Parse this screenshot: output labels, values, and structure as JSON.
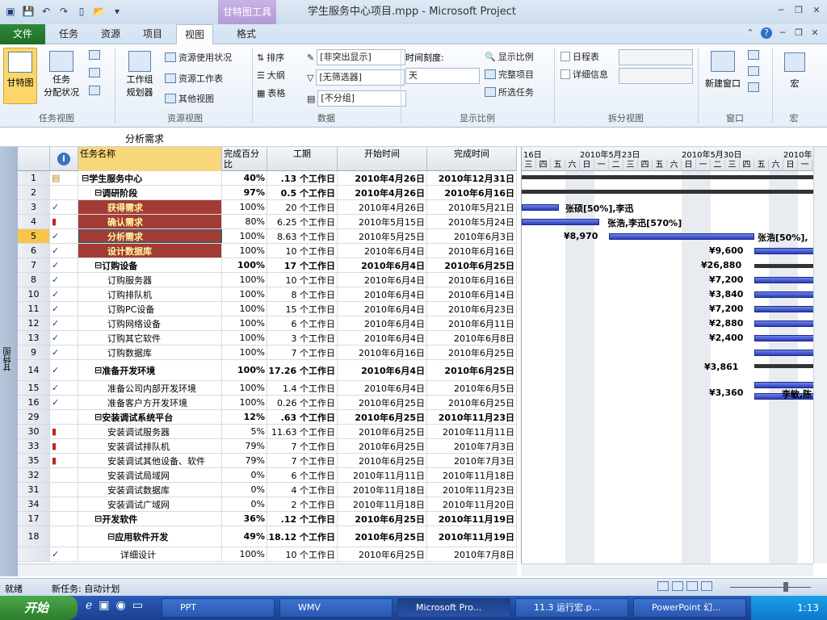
{
  "window": {
    "title": "学生服务中心项目.mpp - Microsoft Project",
    "context_tab_group": "甘特图工具"
  },
  "tabs": [
    "任务",
    "资源",
    "项目",
    "视图",
    "格式"
  ],
  "file_tab": "文件",
  "ribbon": {
    "task_view": {
      "gantt": "甘特图",
      "assign": "任务\n分配状况",
      "label": "任务视图"
    },
    "resource_view": {
      "team_planner": "工作组\n规划器",
      "usage": "资源使用状况",
      "sheet": "资源工作表",
      "other": "其他视图",
      "label": "资源视图"
    },
    "data": {
      "sort": "排序",
      "outline": "大纲",
      "tables": "表格",
      "highlight": "[非突出显示]",
      "filter": "[无筛选器]",
      "group": "[不分组]",
      "label": "数据"
    },
    "zoom": {
      "timescale_label": "时间刻度:",
      "timescale_value": "天",
      "zoom": "显示比例",
      "entire_project": "完整项目",
      "selected_tasks": "所选任务",
      "label": "显示比例"
    },
    "split": {
      "timeline": "日程表",
      "details": "详细信息",
      "label": "拆分视图"
    },
    "window": {
      "new_window": "新建窗口",
      "label": "窗口"
    },
    "macros": {
      "macros": "宏",
      "label": "宏"
    }
  },
  "entry_bar": {
    "value": "分析需求"
  },
  "grid": {
    "headers": {
      "info": "i",
      "name": "任务名称",
      "pct": "完成百分比",
      "duration": "工期",
      "start": "开始时间",
      "finish": "完成时间"
    },
    "rows": [
      {
        "id": "1",
        "ind": "note",
        "name": "学生服务中心",
        "lvl": 0,
        "sum": true,
        "pct": "40%",
        "dur": ".13 个工作日",
        "start": "2010年4月26日",
        "finish": "2010年12月31日"
      },
      {
        "id": "2",
        "ind": "",
        "name": "调研阶段",
        "lvl": 1,
        "sum": true,
        "pct": "97%",
        "dur": "0.5 个工作日",
        "start": "2010年4月26日",
        "finish": "2010年6月16日"
      },
      {
        "id": "3",
        "ind": "check",
        "name": "获得需求",
        "lvl": 2,
        "hl": true,
        "pct": "100%",
        "dur": "20 个工作日",
        "start": "2010年4月26日",
        "finish": "2010年5月21日"
      },
      {
        "id": "4",
        "ind": "person",
        "name": "确认需求",
        "lvl": 2,
        "hl": true,
        "pct": "80%",
        "dur": "6.25 个工作日",
        "start": "2010年5月15日",
        "finish": "2010年5月24日"
      },
      {
        "id": "5",
        "ind": "check",
        "name": "分析需求",
        "lvl": 2,
        "hl": true,
        "sel": true,
        "pct": "100%",
        "dur": "8.63 个工作日",
        "start": "2010年5月25日",
        "finish": "2010年6月3日"
      },
      {
        "id": "6",
        "ind": "check",
        "name": "设计数据库",
        "lvl": 2,
        "hl": true,
        "pct": "100%",
        "dur": "10 个工作日",
        "start": "2010年6月4日",
        "finish": "2010年6月16日"
      },
      {
        "id": "7",
        "ind": "check",
        "name": "订购设备",
        "lvl": 1,
        "sum": true,
        "pct": "100%",
        "dur": "17 个工作日",
        "start": "2010年6月4日",
        "finish": "2010年6月25日"
      },
      {
        "id": "8",
        "ind": "check",
        "name": "订购服务器",
        "lvl": 2,
        "pct": "100%",
        "dur": "10 个工作日",
        "start": "2010年6月4日",
        "finish": "2010年6月16日"
      },
      {
        "id": "10",
        "ind": "check",
        "name": "订购排队机",
        "lvl": 2,
        "pct": "100%",
        "dur": "8 个工作日",
        "start": "2010年6月4日",
        "finish": "2010年6月14日"
      },
      {
        "id": "11",
        "ind": "check",
        "name": "订购PC设备",
        "lvl": 2,
        "pct": "100%",
        "dur": "15 个工作日",
        "start": "2010年6月4日",
        "finish": "2010年6月23日"
      },
      {
        "id": "12",
        "ind": "check",
        "name": "订购网络设备",
        "lvl": 2,
        "pct": "100%",
        "dur": "6 个工作日",
        "start": "2010年6月4日",
        "finish": "2010年6月11日"
      },
      {
        "id": "13",
        "ind": "check",
        "name": "订购其它软件",
        "lvl": 2,
        "pct": "100%",
        "dur": "3 个工作日",
        "start": "2010年6月4日",
        "finish": "2010年6月8日"
      },
      {
        "id": "9",
        "ind": "check",
        "name": "订购数据库",
        "lvl": 2,
        "pct": "100%",
        "dur": "7 个工作日",
        "start": "2010年6月16日",
        "finish": "2010年6月25日"
      },
      {
        "id": "14",
        "ind": "check",
        "name": "准备开发环境",
        "lvl": 1,
        "sum": true,
        "tall": true,
        "pct": "100%",
        "dur": "17.26 个工作日",
        "start": "2010年6月4日",
        "finish": "2010年6月25日"
      },
      {
        "id": "15",
        "ind": "check",
        "name": "准备公司内部开发环境",
        "lvl": 2,
        "pct": "100%",
        "dur": "1.4 个工作日",
        "start": "2010年6月4日",
        "finish": "2010年6月5日"
      },
      {
        "id": "16",
        "ind": "check",
        "name": "准备客户方开发环境",
        "lvl": 2,
        "pct": "100%",
        "dur": "0.26 个工作日",
        "start": "2010年6月25日",
        "finish": "2010年6月25日"
      },
      {
        "id": "29",
        "ind": "",
        "name": "安装调试系统平台",
        "lvl": 1,
        "sum": true,
        "pct": "12%",
        "dur": ".63 个工作日",
        "start": "2010年6月25日",
        "finish": "2010年11月23日"
      },
      {
        "id": "30",
        "ind": "person",
        "name": "安装调试服务器",
        "lvl": 2,
        "pct": "5%",
        "dur": "11.63 个工作日",
        "start": "2010年6月25日",
        "finish": "2010年11月11日"
      },
      {
        "id": "33",
        "ind": "person",
        "name": "安装调试排队机",
        "lvl": 2,
        "pct": "79%",
        "dur": "7 个工作日",
        "start": "2010年6月25日",
        "finish": "2010年7月3日"
      },
      {
        "id": "35",
        "ind": "person",
        "name": "安装调试其他设备、软件",
        "lvl": 2,
        "pct": "79%",
        "dur": "7 个工作日",
        "start": "2010年6月25日",
        "finish": "2010年7月3日"
      },
      {
        "id": "32",
        "ind": "",
        "name": "安装调试局域网",
        "lvl": 2,
        "pct": "0%",
        "dur": "6 个工作日",
        "start": "2010年11月11日",
        "finish": "2010年11月18日"
      },
      {
        "id": "31",
        "ind": "",
        "name": "安装调试数据库",
        "lvl": 2,
        "pct": "0%",
        "dur": "4 个工作日",
        "start": "2010年11月18日",
        "finish": "2010年11月23日"
      },
      {
        "id": "34",
        "ind": "",
        "name": "安装调试广域网",
        "lvl": 2,
        "pct": "0%",
        "dur": "2 个工作日",
        "start": "2010年11月18日",
        "finish": "2010年11月20日"
      },
      {
        "id": "17",
        "ind": "",
        "name": "开发软件",
        "lvl": 1,
        "sum": true,
        "pct": "36%",
        "dur": ".12 个工作日",
        "start": "2010年6月25日",
        "finish": "2010年11月19日"
      },
      {
        "id": "18",
        "ind": "",
        "name": "应用软件开发",
        "lvl": 2,
        "sum": true,
        "tall": true,
        "pct": "49%",
        "dur": "118.12 个工作日",
        "start": "2010年6月25日",
        "finish": "2010年11月19日"
      },
      {
        "id": "",
        "ind": "check",
        "name": "详细设计",
        "lvl": 3,
        "pct": "100%",
        "dur": "10 个工作日",
        "start": "2010年6月25日",
        "finish": "2010年7月8日"
      }
    ]
  },
  "gantt": {
    "weeks": [
      "16日",
      "2010年5月23日",
      "2010年5月30日",
      "2010年"
    ],
    "days": [
      "三",
      "四",
      "五",
      "六",
      "日",
      "一",
      "二",
      "三",
      "四",
      "五",
      "六",
      "日",
      "一",
      "二",
      "三",
      "四",
      "五",
      "六",
      "日",
      "一"
    ],
    "labels": [
      "张硕[50%],李迅",
      "张浩,李迅[570%]",
      "¥8,970",
      "张浩[50%],",
      "¥9,600",
      "¥26,880",
      "¥7,200",
      "¥3,840",
      "¥7,200",
      "¥2,880",
      "¥2,400",
      "¥3,861",
      "¥3,360",
      "李敏,陈"
    ]
  },
  "status": {
    "ready": "就绪",
    "new_tasks": "新任务: 自动计划"
  },
  "taskbar": {
    "start": "开始",
    "items": [
      "PPT",
      "WMV",
      "Microsoft Pro...",
      "11.3 运行宏.p...",
      "PowerPoint 幻..."
    ],
    "time": "1:13"
  }
}
